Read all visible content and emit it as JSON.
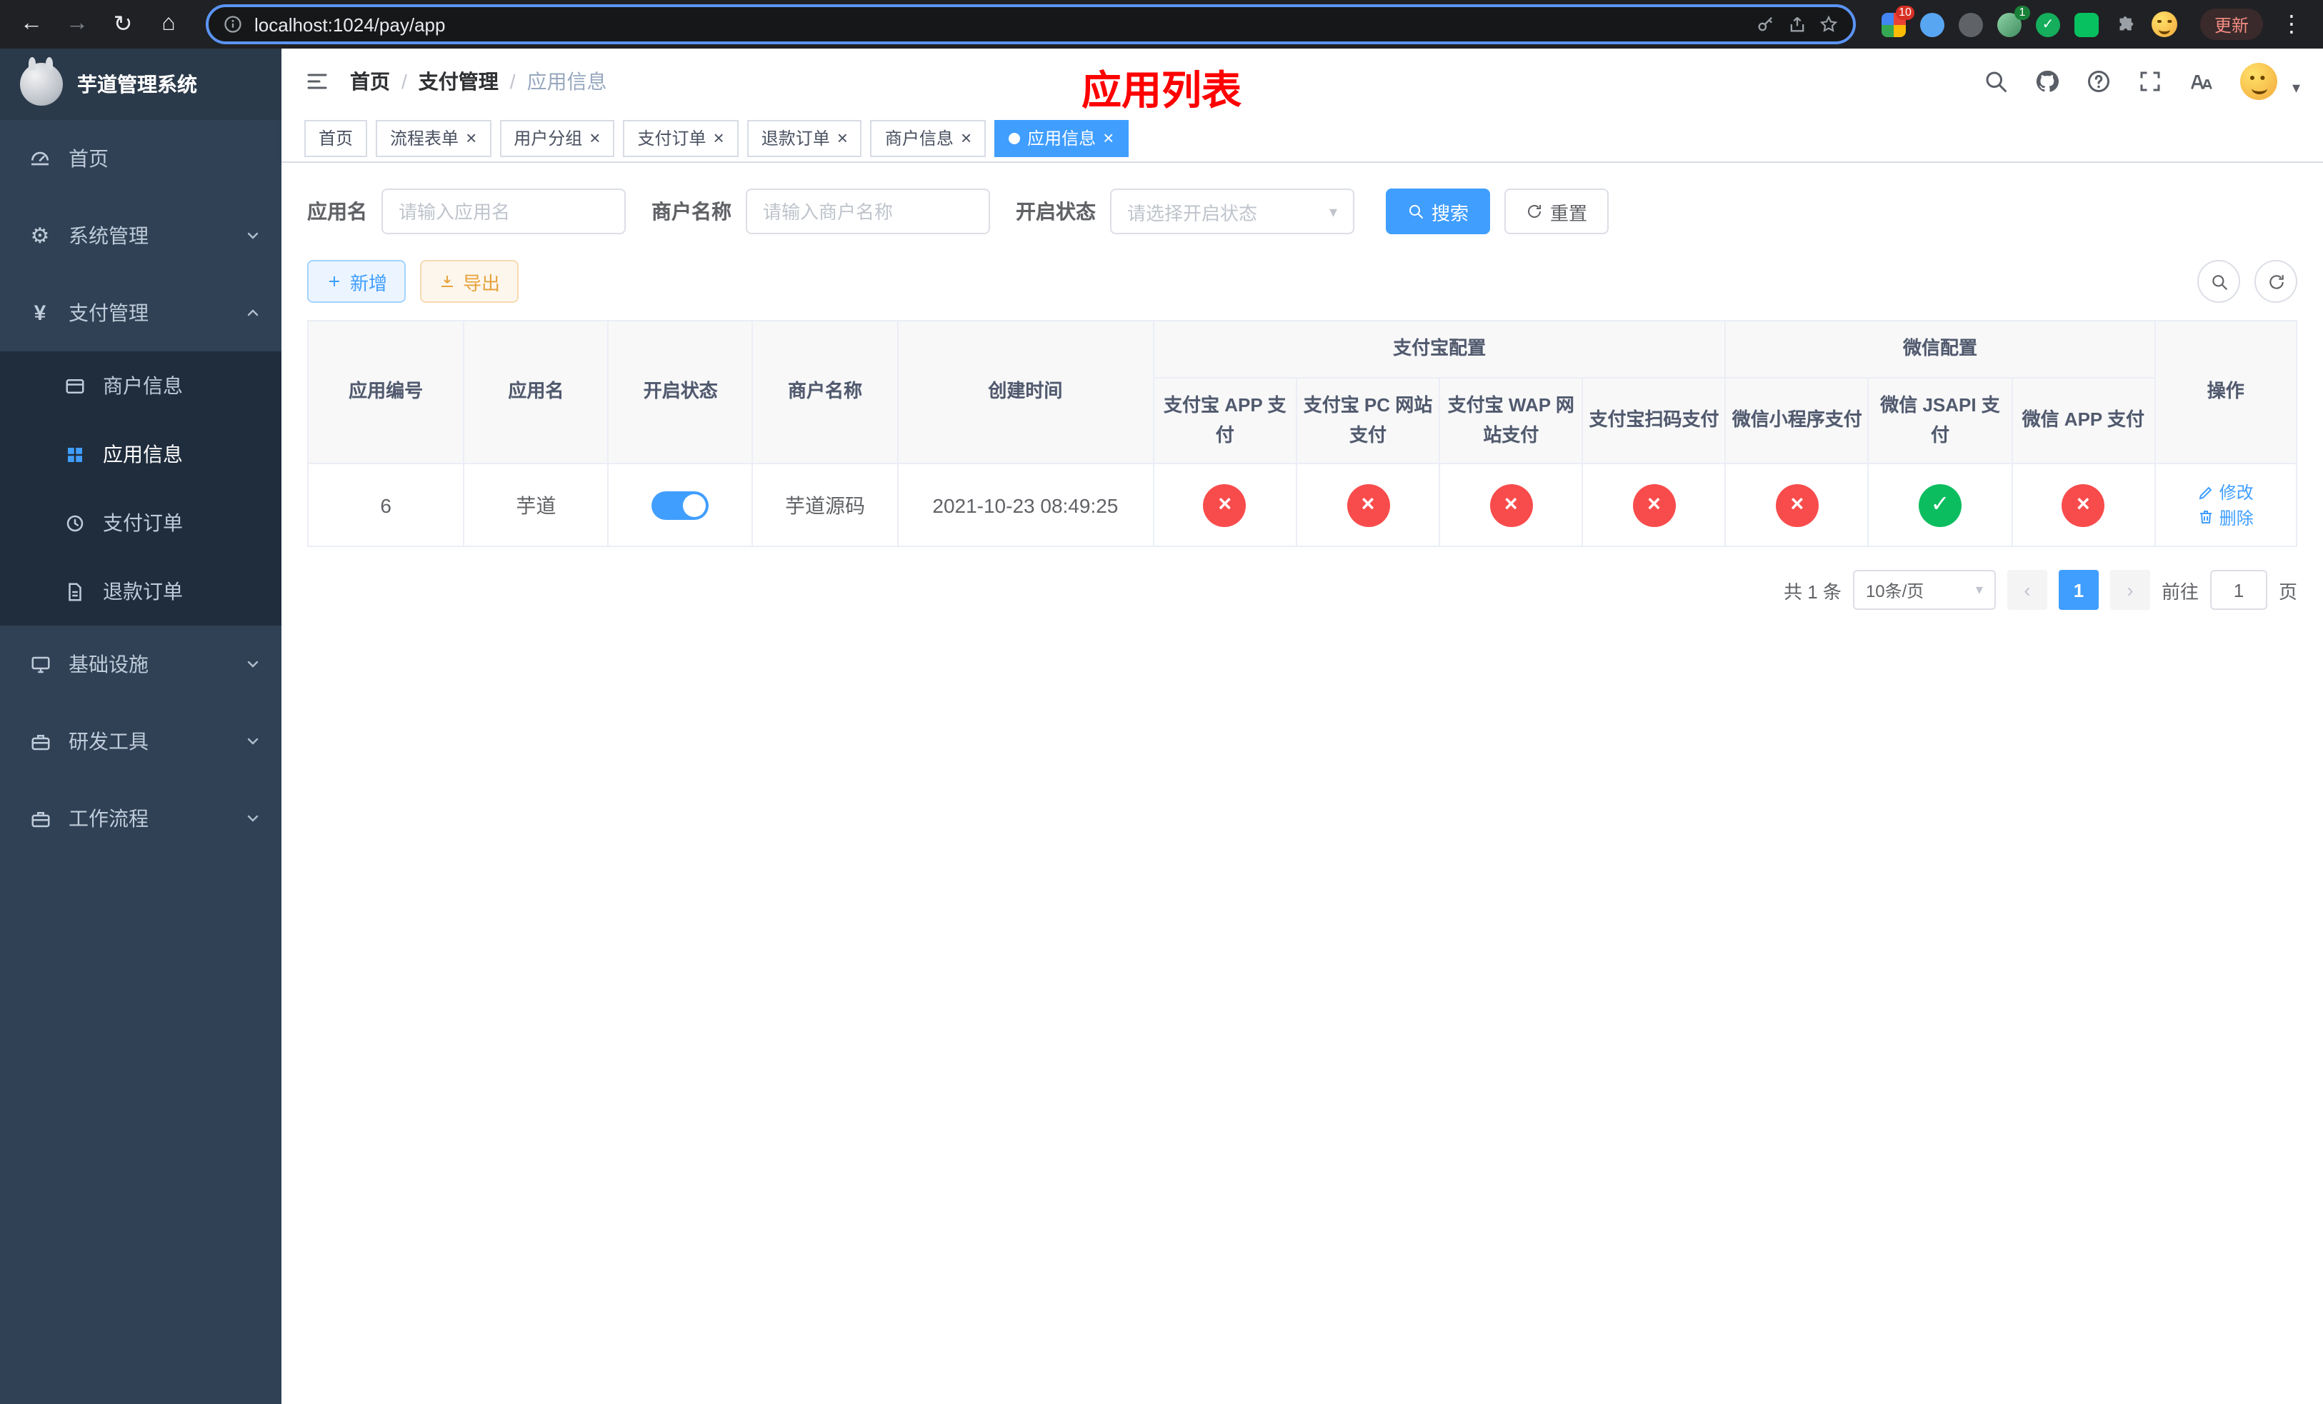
{
  "browser": {
    "url": "localhost:1024/pay/app",
    "update_label": "更新",
    "ext_badge_red": "10",
    "ext_badge_green": "1"
  },
  "sidebar": {
    "title": "芋道管理系统",
    "home": "首页",
    "system": "系统管理",
    "payment": "支付管理",
    "merchant_info": "商户信息",
    "app_info": "应用信息",
    "pay_order": "支付订单",
    "refund_order": "退款订单",
    "infra": "基础设施",
    "dev_tools": "研发工具",
    "workflow": "工作流程"
  },
  "header": {
    "breadcrumb": {
      "home": "首页",
      "level1": "支付管理",
      "level2": "应用信息"
    },
    "page_title": "应用列表"
  },
  "tabs": [
    {
      "label": "首页"
    },
    {
      "label": "流程表单"
    },
    {
      "label": "用户分组"
    },
    {
      "label": "支付订单"
    },
    {
      "label": "退款订单"
    },
    {
      "label": "商户信息"
    },
    {
      "label": "应用信息"
    }
  ],
  "filters": {
    "app_name_label": "应用名",
    "app_name_placeholder": "请输入应用名",
    "merchant_label": "商户名称",
    "merchant_placeholder": "请输入商户名称",
    "status_label": "开启状态",
    "status_placeholder": "请选择开启状态",
    "search_label": "搜索",
    "reset_label": "重置"
  },
  "toolbar": {
    "add_label": "新增",
    "export_label": "导出"
  },
  "table": {
    "col_app_id": "应用编号",
    "col_app_name": "应用名",
    "col_status": "开启状态",
    "col_merchant": "商户名称",
    "col_create_time": "创建时间",
    "group_alipay": "支付宝配置",
    "group_wechat": "微信配置",
    "col_alipay_app": "支付宝 APP 支付",
    "col_alipay_pc": "支付宝 PC 网站支付",
    "col_alipay_wap": "支付宝 WAP 网站支付",
    "col_alipay_qr": "支付宝扫码支付",
    "col_wx_mini": "微信小程序支付",
    "col_wx_jsapi": "微信 JSAPI 支付",
    "col_wx_app": "微信 APP 支付",
    "col_actions": "操作",
    "rows": [
      {
        "app_id": "6",
        "app_name": "芋道",
        "status_on": true,
        "merchant": "芋道源码",
        "create_time": "2021-10-23 08:49:25",
        "alipay_app": false,
        "alipay_pc": false,
        "alipay_wap": false,
        "alipay_qr": false,
        "wx_mini": false,
        "wx_jsapi": true,
        "wx_app": false,
        "edit_label": "修改",
        "delete_label": "删除"
      }
    ]
  },
  "pagination": {
    "total": "共 1 条",
    "page_size": "10条/页",
    "page": "1",
    "goto_label": "前往",
    "goto_value": "1",
    "goto_unit": "页"
  },
  "colors": {
    "accent": "#409eff",
    "danger": "#f84c4c",
    "success": "#0cbd5f",
    "warning": "#e6a23c",
    "title_red": "#ff0000",
    "sidebar_bg": "#304156",
    "submenu_bg": "#1f2d3d"
  }
}
